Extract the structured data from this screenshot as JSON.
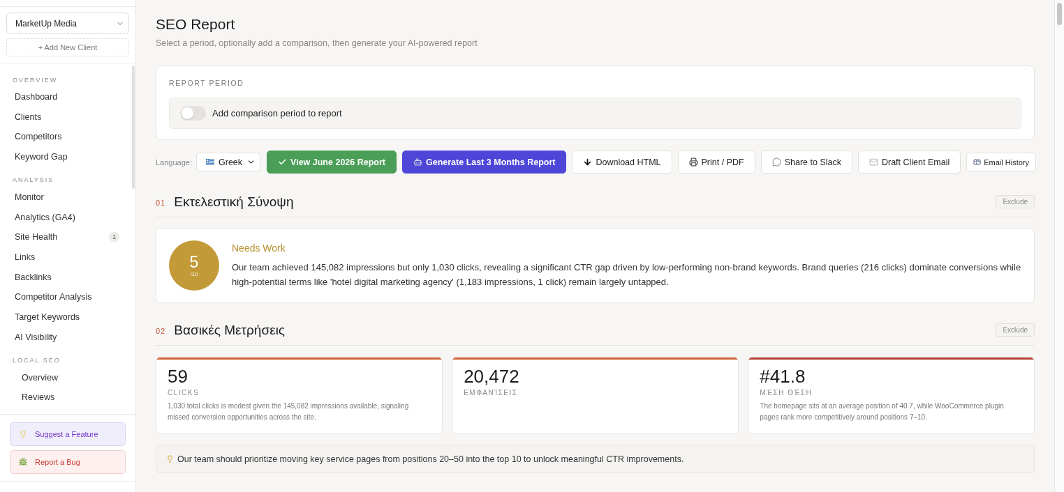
{
  "sidebar": {
    "client": {
      "value": "MarketUp Media"
    },
    "add_client": "+ Add New Client",
    "nav": [
      {
        "kind": "group",
        "label": "OVERVIEW",
        "items": [
          {
            "label": "Dashboard"
          },
          {
            "label": "Clients"
          },
          {
            "label": "Competitors"
          },
          {
            "label": "Keyword Gap"
          }
        ]
      },
      {
        "kind": "group",
        "label": "ANALYSIS",
        "items": [
          {
            "label": "Monitor"
          },
          {
            "label": "Analytics (GA4)"
          },
          {
            "label": "Site Health",
            "badge": "1"
          },
          {
            "label": "Links"
          },
          {
            "label": "Backlinks"
          },
          {
            "label": "Competitor Analysis"
          },
          {
            "label": "Target Keywords"
          },
          {
            "label": "AI Visibility"
          }
        ]
      },
      {
        "kind": "subgroup",
        "label": "LOCAL SEO",
        "items": [
          {
            "label": "Overview"
          },
          {
            "label": "Reviews"
          }
        ]
      }
    ],
    "feedback": [
      {
        "kind": "suggest",
        "label": "Suggest a Feature"
      },
      {
        "kind": "bug",
        "label": "Report a Bug"
      }
    ]
  },
  "header": {
    "title": "SEO Report",
    "subtitle": "Select a period, optionally add a comparison, then generate your AI-powered report"
  },
  "report_period": {
    "label": "REPORT PERIOD",
    "comparison_toggle": {
      "label": "Add comparison period to report",
      "on": false
    }
  },
  "actions": {
    "language_label": "Language:",
    "language": {
      "value": "Greek"
    },
    "buttons": [
      {
        "kind": "view",
        "label": "View June 2026 Report"
      },
      {
        "kind": "generate",
        "label": "Generate Last 3 Months Report"
      },
      {
        "kind": "download",
        "label": "Download HTML"
      },
      {
        "kind": "print",
        "label": "Print / PDF"
      },
      {
        "kind": "slack",
        "label": "Share to Slack"
      },
      {
        "kind": "email",
        "label": "Draft Client Email"
      },
      {
        "kind": "history",
        "label": "Email History"
      }
    ]
  },
  "sections": [
    {
      "kind": "summary",
      "number": "01",
      "title": "Εκτελεστική Σύνοψη",
      "exclude": "Exclude",
      "score": {
        "value": "5",
        "scale": "/10"
      },
      "rating": "Needs Work",
      "text": "Our team achieved 145,082 impressions but only 1,030 clicks, revealing a significant CTR gap driven by low-performing non-brand keywords. Brand queries (216 clicks) dominate conversions while high-potential terms like 'hotel digital marketing agency' (1,183 impressions, 1 click) remain largely untapped."
    },
    {
      "kind": "metrics",
      "number": "02",
      "title": "Βασικές Μετρήσεις",
      "exclude": "Exclude",
      "metrics": [
        {
          "value": "59",
          "label": "CLICKS",
          "description": "1,030 total clicks is modest given the 145,082 impressions available, signaling missed conversion opportunities across the site.",
          "color": "#d2663f"
        },
        {
          "value": "20,472",
          "label": "ΕΜΦΑΝΊΣΕΙΣ",
          "color": "#d2663f"
        },
        {
          "value": "#41.8",
          "label": "ΜΈΣΗ ΘΈΣΗ",
          "description": "The homepage sits at an average position of 40.7, while WooCommerce plugin pages rank more competitively around positions 7–10.",
          "color": "#b8423a"
        }
      ],
      "insight": "Our team should prioritize moving key service pages from positions 20–50 into the top 10 to unlock meaningful CTR improvements."
    }
  ]
}
